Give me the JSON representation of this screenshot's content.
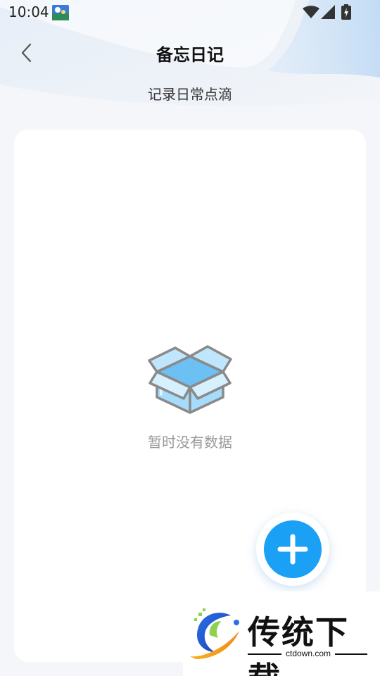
{
  "status_bar": {
    "time": "10:04",
    "icons": [
      "app-notification-icon",
      "wifi-icon",
      "signal-icon",
      "battery-charging-icon"
    ]
  },
  "header": {
    "back_icon": "chevron-left-icon",
    "title": "备忘日记",
    "subtitle": "记录日常点滴"
  },
  "content": {
    "empty_icon": "open-box-icon",
    "empty_text": "暂时没有数据"
  },
  "fab": {
    "icon": "plus-icon"
  },
  "watermark": {
    "title": "传统下载",
    "url": "ctdown.com"
  },
  "colors": {
    "accent": "#1aa0f5",
    "background": "#f4f6f9",
    "card": "#ffffff",
    "empty_text": "#9a9a9a",
    "box_blue": "#8fd0f6",
    "box_outline": "#8a8a8a"
  }
}
